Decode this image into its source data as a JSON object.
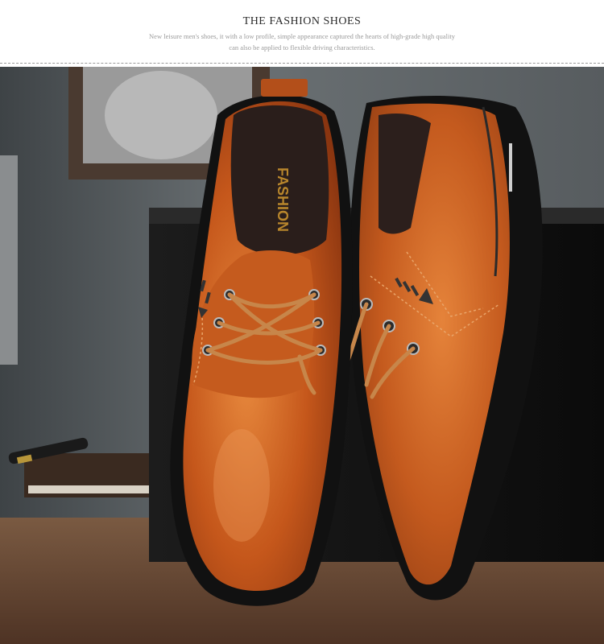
{
  "header": {
    "title": "THE FASHION SHOES",
    "subtitle_line1": "New leisure men's shoes, it with a low profile, simple appearance captured the hearts of high-grade high quality",
    "subtitle_line2": "can also be applied to flexible driving characteristics."
  },
  "photo": {
    "insole_brand": "FASHION",
    "colors": {
      "leather": "#c45a1e",
      "leather_light": "#e0853a",
      "sole": "#151515",
      "wall": "#5f6568",
      "table": "#6b4a34"
    }
  }
}
